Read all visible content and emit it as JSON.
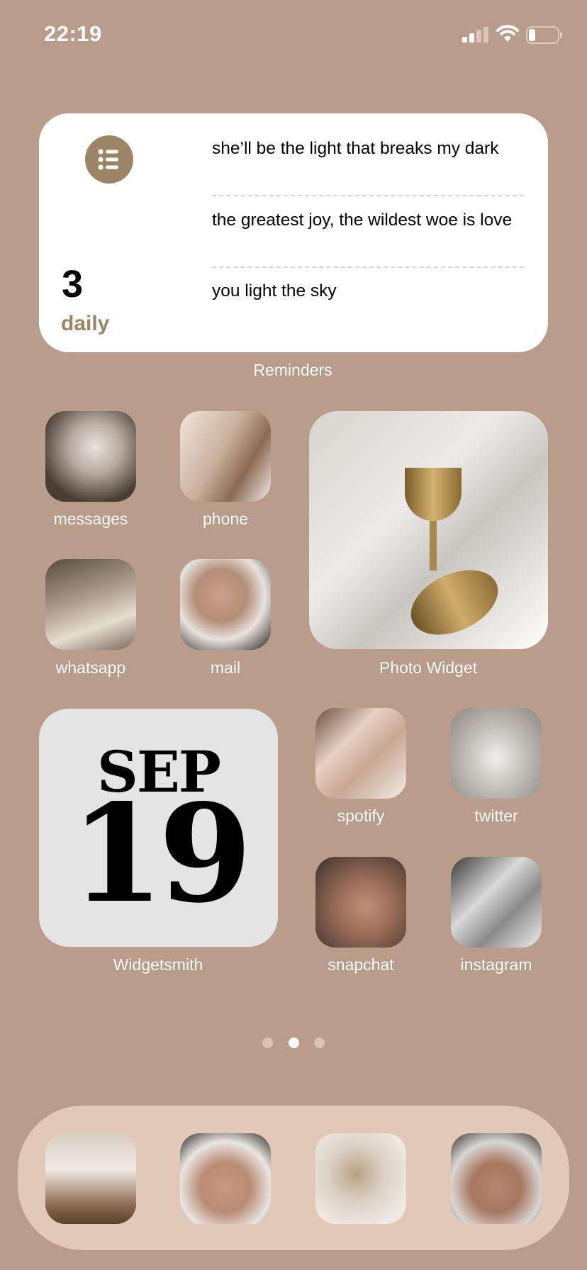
{
  "status_bar": {
    "time": "22:19",
    "signal_bars": 2,
    "battery_level": 0.2
  },
  "reminders_widget": {
    "icon": "list-bullet-icon",
    "accent": "#9b8566",
    "count": "3",
    "list_name": "daily",
    "items": [
      "she’ll be the light that breaks my dark",
      "the greatest joy, the wildest woe is love",
      "you light the sky"
    ],
    "label": "Reminders"
  },
  "apps": {
    "messages": "messages",
    "phone": "phone",
    "whatsapp": "whatsapp",
    "mail": "mail",
    "spotify": "spotify",
    "twitter": "twitter",
    "snapchat": "snapchat",
    "instagram": "instagram"
  },
  "photo_widget": {
    "label": "Photo Widget"
  },
  "calendar_widget": {
    "month": "SEP",
    "day": "19",
    "label": "Widgetsmith"
  },
  "page_dots": {
    "count": 3,
    "active": 2
  },
  "colors": {
    "background": "#b99d8a",
    "dock": "#e2c8b6"
  }
}
